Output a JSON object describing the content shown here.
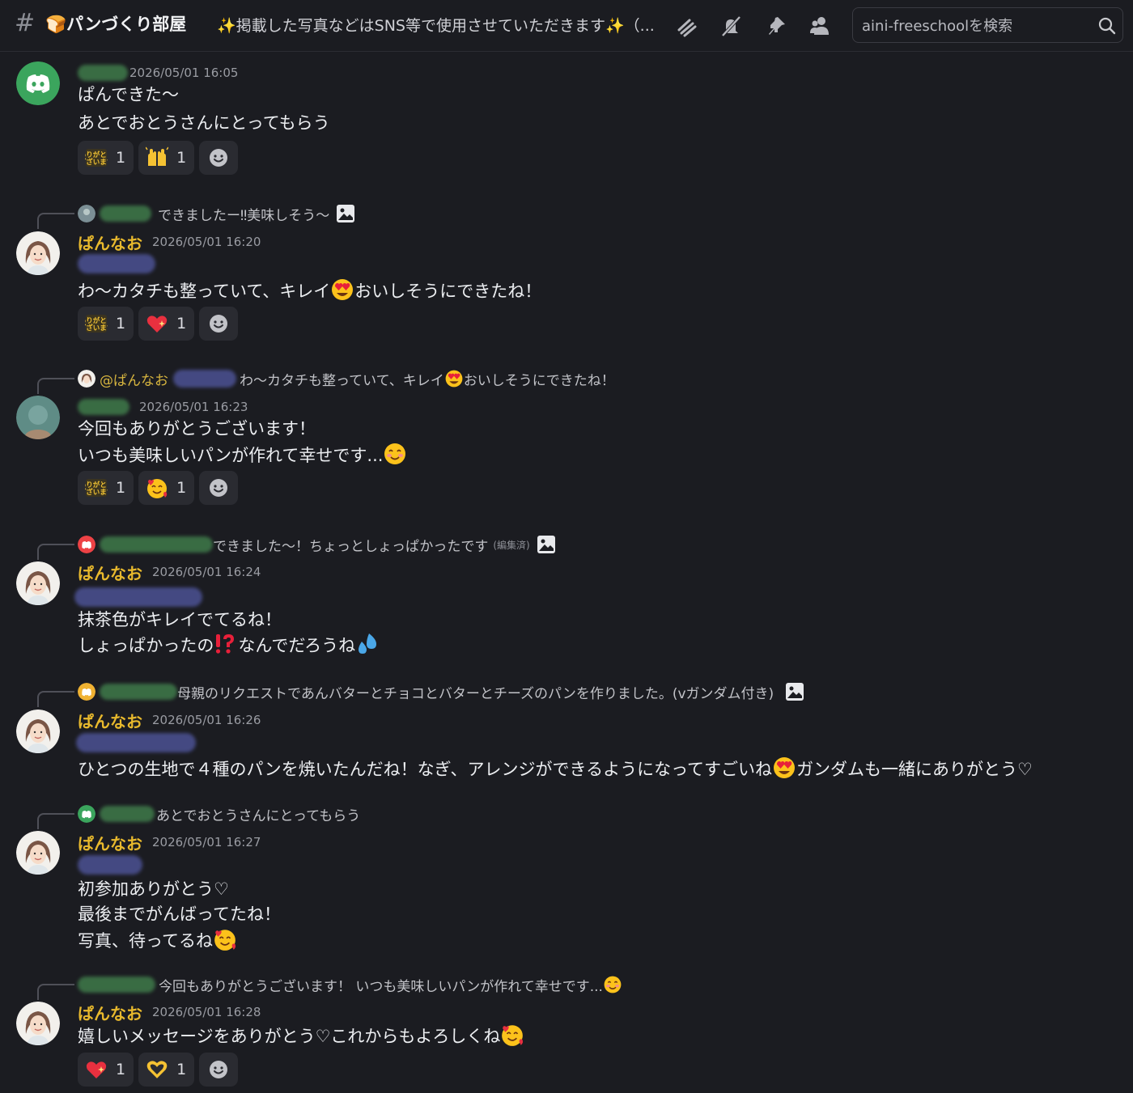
{
  "header": {
    "channel_name": "🍞パンづくり部屋",
    "topic": "✨掲載した写真などはSNS等で使用させていただきます✨（...",
    "search_placeholder": "aini-freeschoolを検索"
  },
  "colors": {
    "background": "#1b1c21",
    "username_gold": "#e8b92d",
    "reaction_bg": "#2a2b31",
    "blurred_name_green": "#3f7a4a",
    "blurred_role_blue": "#4c5294"
  },
  "messages": [
    {
      "timestamp": "2026/05/01 16:05",
      "lines": [
        "ぱんできた〜",
        "あとでおとうさんにとってもらう"
      ],
      "reactions": [
        {
          "icon": "arigatou-gozaimasu-sticker",
          "count": "1"
        },
        {
          "icon": "raised-hands-emoji",
          "count": "1"
        }
      ]
    },
    {
      "reply_text": "できましたー‼美味しそう〜",
      "username": "ぱんなお",
      "timestamp": "2026/05/01 16:20",
      "text_before": "わ〜カタチも整っていて、キレイ",
      "text_after": "おいしそうにできたね！",
      "reactions": [
        {
          "icon": "arigatou-gozaimasu-sticker",
          "count": "1"
        },
        {
          "icon": "sparkling-heart-emoji",
          "count": "1"
        }
      ]
    },
    {
      "reply_mention": "@ぱんなお",
      "reply_text_before": "わ〜カタチも整っていて、キレイ",
      "reply_text_after": "おいしそうにできたね！",
      "timestamp": "2026/05/01 16:23",
      "line1": "今回もありがとうございます！",
      "line2": "いつも美味しいパンが作れて幸せです...",
      "reactions": [
        {
          "icon": "arigatou-gozaimasu-sticker",
          "count": "1"
        },
        {
          "icon": "smiling-face-with-hearts-emoji",
          "count": "1"
        }
      ]
    },
    {
      "reply_text": "できました〜！ちょっとしょっぱかったです",
      "reply_edited": "(編集済)",
      "username": "ぱんなお",
      "timestamp": "2026/05/01 16:24",
      "line1": "抹茶色がキレイでてるね！",
      "line2_before": "しょっぱかったの",
      "line2_after": "なんでだろうね"
    },
    {
      "reply_text": "母親のリクエストであんバターとチョコとバターとチーズのパンを作りました。(vガンダム付き)",
      "username": "ぱんなお",
      "timestamp": "2026/05/01 16:26",
      "text_before": "ひとつの生地で４種のパンを焼いたんだね！なぎ、アレンジができるようになってすごいね",
      "text_after": "ガンダムも一緒にありがとう♡"
    },
    {
      "reply_text": "あとでおとうさんにとってもらう",
      "username": "ぱんなお",
      "timestamp": "2026/05/01 16:27",
      "line1": "初参加ありがとう♡",
      "line2": "最後までがんばってたね！",
      "line3": "写真、待ってるね"
    },
    {
      "reply_text": "今回もありがとうございます！ いつも美味しいパンが作れて幸せです...",
      "username": "ぱんなお",
      "timestamp": "2026/05/01 16:28",
      "text": "嬉しいメッセージをありがとう♡これからもよろしくね",
      "reactions": [
        {
          "icon": "sparkling-heart-emoji",
          "count": "1"
        },
        {
          "icon": "heart-hands-emoji",
          "count": "1"
        }
      ]
    }
  ]
}
